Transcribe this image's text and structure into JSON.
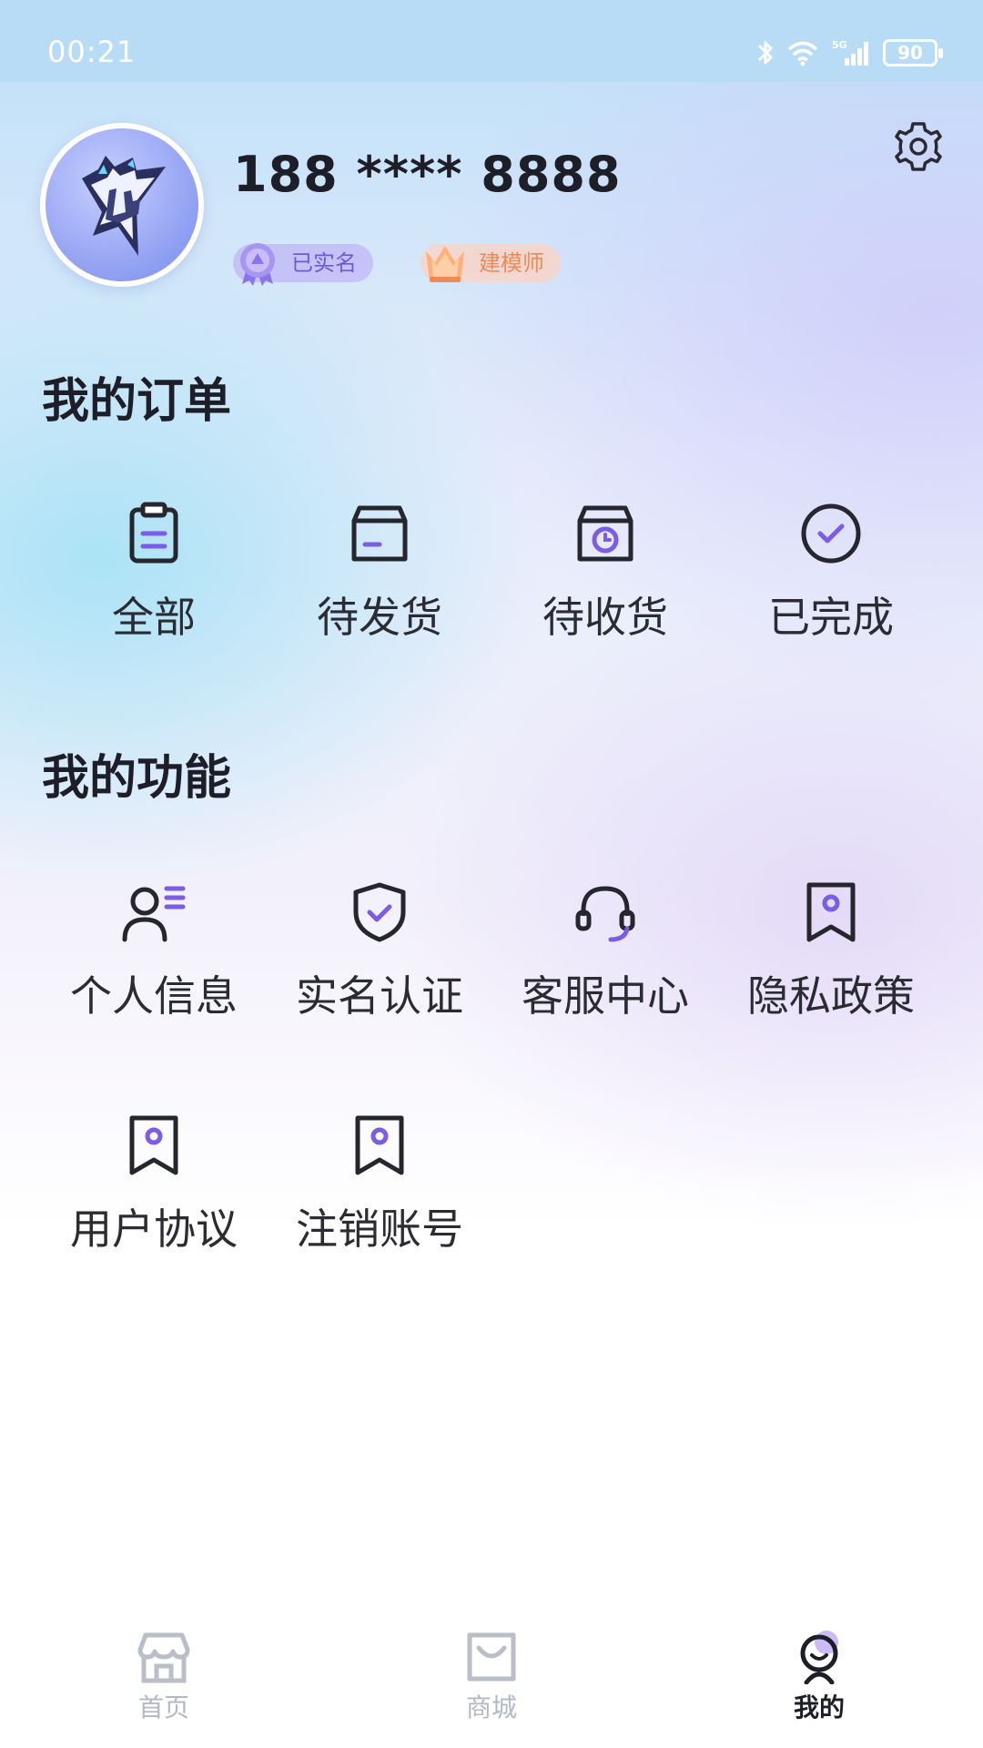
{
  "status_bar": {
    "time": "00:21",
    "battery": "90"
  },
  "profile": {
    "phone": "188 **** 8888",
    "badges": [
      {
        "label": "已实名",
        "icon": "medal-icon"
      },
      {
        "label": "建模师",
        "icon": "crown-icon"
      }
    ]
  },
  "orders": {
    "title": "我的订单",
    "items": [
      {
        "label": "全部",
        "icon": "clipboard-icon"
      },
      {
        "label": "待发货",
        "icon": "box-icon"
      },
      {
        "label": "待收货",
        "icon": "box-clock-icon"
      },
      {
        "label": "已完成",
        "icon": "check-circle-icon"
      }
    ]
  },
  "features": {
    "title": "我的功能",
    "items": [
      {
        "label": "个人信息",
        "icon": "user-list-icon"
      },
      {
        "label": "实名认证",
        "icon": "shield-check-icon"
      },
      {
        "label": "客服中心",
        "icon": "headset-icon"
      },
      {
        "label": "隐私政策",
        "icon": "bookmark-icon"
      },
      {
        "label": "用户协议",
        "icon": "bookmark-icon"
      },
      {
        "label": "注销账号",
        "icon": "bookmark-icon"
      }
    ]
  },
  "tabbar": {
    "items": [
      {
        "label": "首页",
        "icon": "store-icon",
        "active": false
      },
      {
        "label": "商城",
        "icon": "shopping-bag-icon",
        "active": false
      },
      {
        "label": "我的",
        "icon": "profile-face-icon",
        "active": true
      }
    ]
  },
  "colors": {
    "accent": "#7b5ce6",
    "text": "#1e1e28",
    "inactive": "#b3b8c4"
  }
}
